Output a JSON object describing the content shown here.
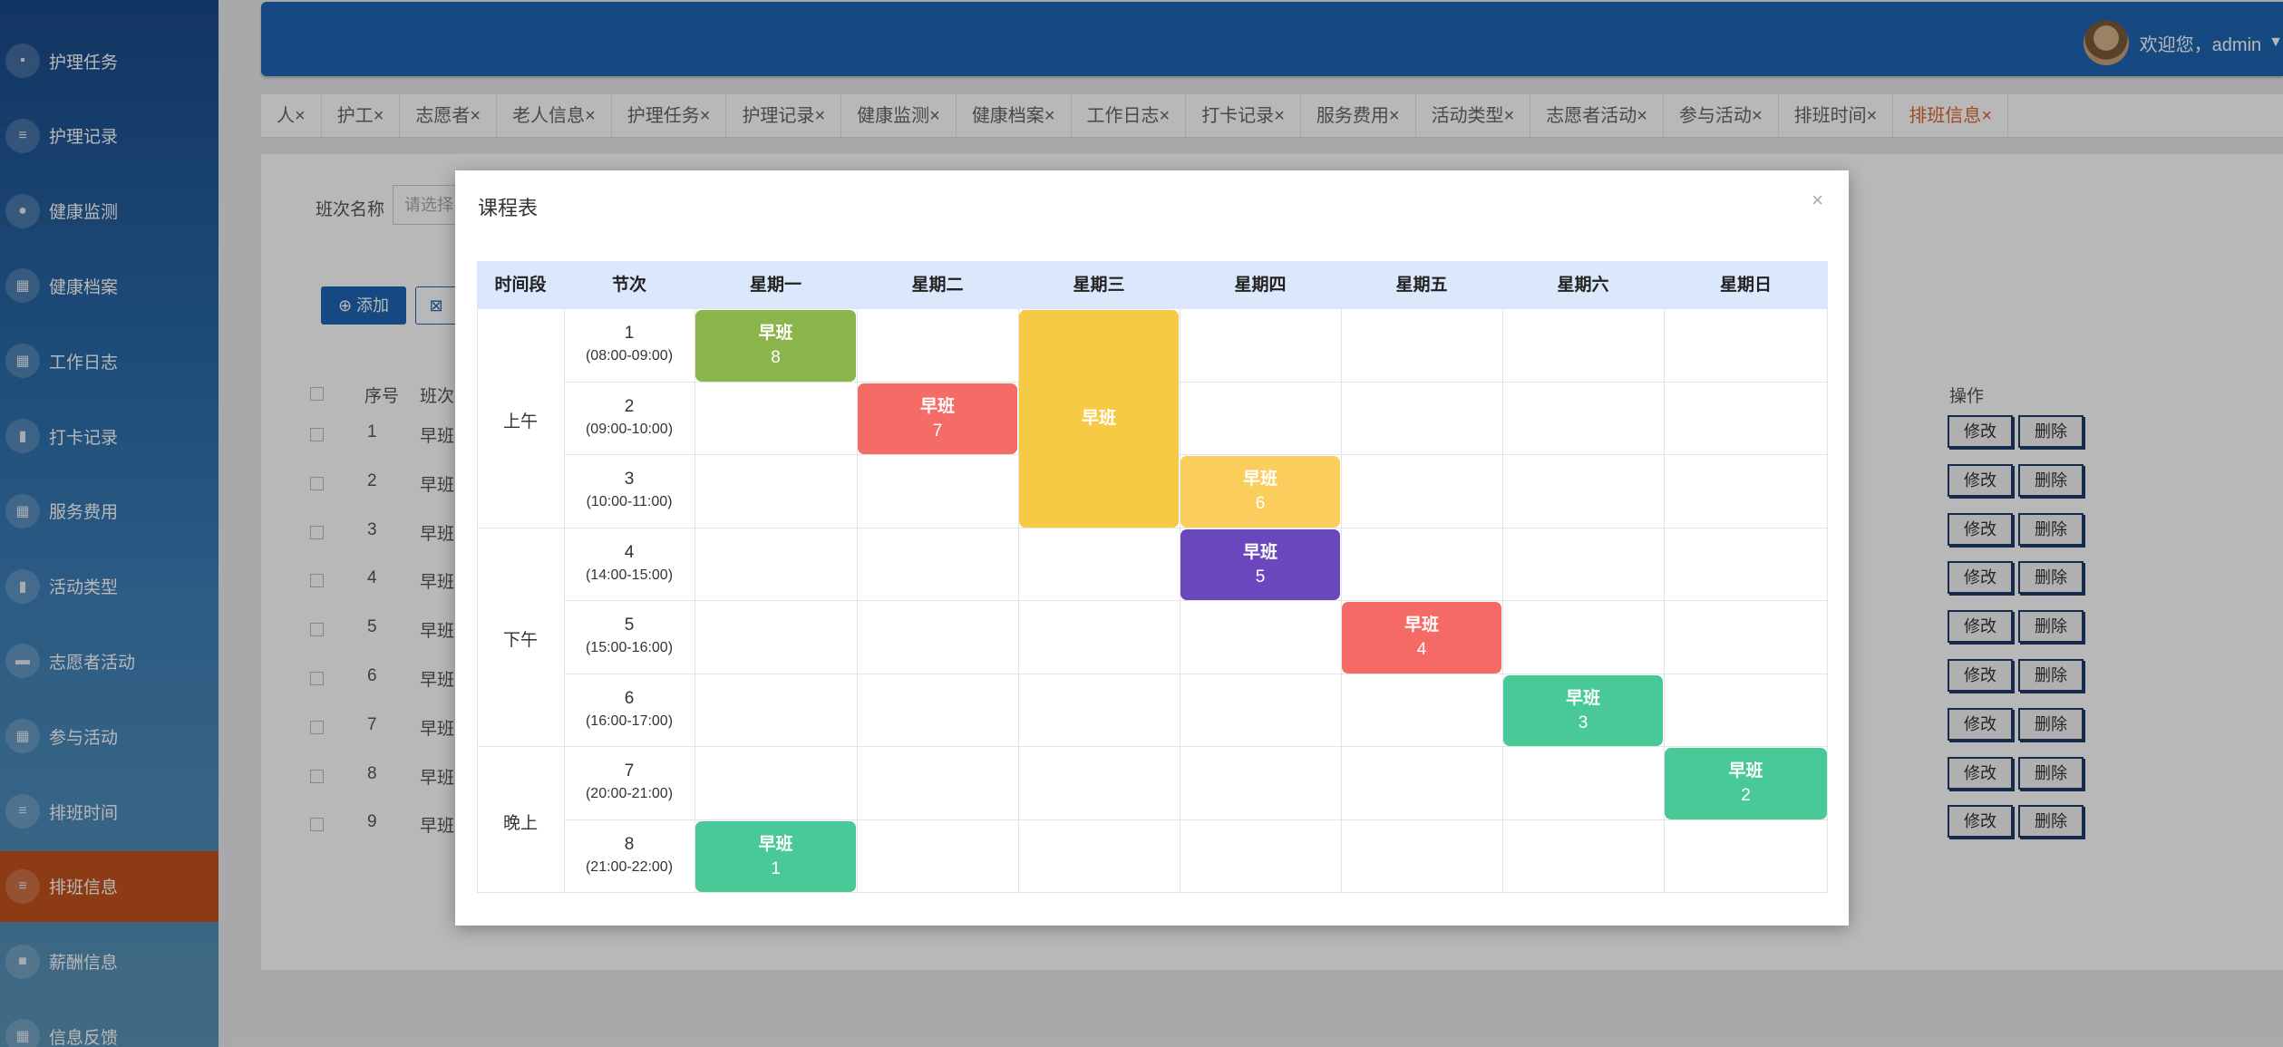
{
  "sidebar": {
    "items": [
      {
        "label": "护理任务",
        "icon": "briefcase-icon"
      },
      {
        "label": "护理记录",
        "icon": "list-icon"
      },
      {
        "label": "健康监测",
        "icon": "pin-icon"
      },
      {
        "label": "健康档案",
        "icon": "grid-icon"
      },
      {
        "label": "工作日志",
        "icon": "grid-icon"
      },
      {
        "label": "打卡记录",
        "icon": "clipboard-icon"
      },
      {
        "label": "服务费用",
        "icon": "grid-icon"
      },
      {
        "label": "活动类型",
        "icon": "clipboard-icon"
      },
      {
        "label": "志愿者活动",
        "icon": "monitor-icon"
      },
      {
        "label": "参与活动",
        "icon": "grid-icon"
      },
      {
        "label": "排班时间",
        "icon": "list-icon"
      },
      {
        "label": "排班信息",
        "icon": "list-icon",
        "active": true
      },
      {
        "label": "薪酬信息",
        "icon": "chat-icon"
      },
      {
        "label": "信息反馈",
        "icon": "grid-icon"
      }
    ]
  },
  "header": {
    "welcome": "欢迎您，admin",
    "caret": "▼"
  },
  "tabs": [
    {
      "label": "人",
      "close": "×"
    },
    {
      "label": "护工",
      "close": "×"
    },
    {
      "label": "志愿者",
      "close": "×"
    },
    {
      "label": "老人信息",
      "close": "×"
    },
    {
      "label": "护理任务",
      "close": "×"
    },
    {
      "label": "护理记录",
      "close": "×"
    },
    {
      "label": "健康监测",
      "close": "×"
    },
    {
      "label": "健康档案",
      "close": "×"
    },
    {
      "label": "工作日志",
      "close": "×"
    },
    {
      "label": "打卡记录",
      "close": "×"
    },
    {
      "label": "服务费用",
      "close": "×"
    },
    {
      "label": "活动类型",
      "close": "×"
    },
    {
      "label": "志愿者活动",
      "close": "×"
    },
    {
      "label": "参与活动",
      "close": "×"
    },
    {
      "label": "排班时间",
      "close": "×"
    },
    {
      "label": "排班信息",
      "close": "×",
      "active": true
    }
  ],
  "filter": {
    "label": "班次名称",
    "placeholder": "请选择"
  },
  "toolbar": {
    "add_label": "添加",
    "add_icon": "⊕",
    "delete_icon": "⊠"
  },
  "table": {
    "headers": {
      "seq": "序号",
      "shift": "班次"
    },
    "op_header": "操作",
    "rows": [
      {
        "seq": "1",
        "shift": "早班"
      },
      {
        "seq": "2",
        "shift": "早班"
      },
      {
        "seq": "3",
        "shift": "早班"
      },
      {
        "seq": "4",
        "shift": "早班"
      },
      {
        "seq": "5",
        "shift": "早班"
      },
      {
        "seq": "6",
        "shift": "早班"
      },
      {
        "seq": "7",
        "shift": "早班"
      },
      {
        "seq": "8",
        "shift": "早班"
      },
      {
        "seq": "9",
        "shift": "早班"
      }
    ],
    "edit_label": "修改",
    "delete_label": "删除"
  },
  "modal": {
    "title": "课程表",
    "close": "×",
    "headers": [
      "时间段",
      "节次",
      "星期一",
      "星期二",
      "星期三",
      "星期四",
      "星期五",
      "星期六",
      "星期日"
    ],
    "periods": [
      "上午",
      "下午",
      "晚上"
    ],
    "slots": [
      {
        "n": "1",
        "t": "(08:00-09:00)"
      },
      {
        "n": "2",
        "t": "(09:00-10:00)"
      },
      {
        "n": "3",
        "t": "(10:00-11:00)"
      },
      {
        "n": "4",
        "t": "(14:00-15:00)"
      },
      {
        "n": "5",
        "t": "(15:00-16:00)"
      },
      {
        "n": "6",
        "t": "(16:00-17:00)"
      },
      {
        "n": "7",
        "t": "(20:00-21:00)"
      },
      {
        "n": "8",
        "t": "(21:00-22:00)"
      }
    ],
    "courses": [
      {
        "name": "早班",
        "id": "8",
        "day": 0,
        "slot": 0,
        "span": 1,
        "color": "#8ab54a"
      },
      {
        "name": "早班",
        "id": "7",
        "day": 1,
        "slot": 1,
        "span": 1,
        "color": "#f56b66"
      },
      {
        "name": "早班",
        "id": "",
        "day": 2,
        "slot": 0,
        "span": 3,
        "color": "#f7ca45"
      },
      {
        "name": "早班",
        "id": "6",
        "day": 3,
        "slot": 2,
        "span": 1,
        "color": "#fbcd5c"
      },
      {
        "name": "早班",
        "id": "5",
        "day": 3,
        "slot": 3,
        "span": 1,
        "color": "#6b47bd"
      },
      {
        "name": "早班",
        "id": "4",
        "day": 4,
        "slot": 4,
        "span": 1,
        "color": "#f66a66"
      },
      {
        "name": "早班",
        "id": "3",
        "day": 5,
        "slot": 5,
        "span": 1,
        "color": "#48c997"
      },
      {
        "name": "早班",
        "id": "2",
        "day": 6,
        "slot": 6,
        "span": 1,
        "color": "#48c997"
      },
      {
        "name": "早班",
        "id": "1",
        "day": 0,
        "slot": 7,
        "span": 1,
        "color": "#48c997"
      }
    ]
  }
}
